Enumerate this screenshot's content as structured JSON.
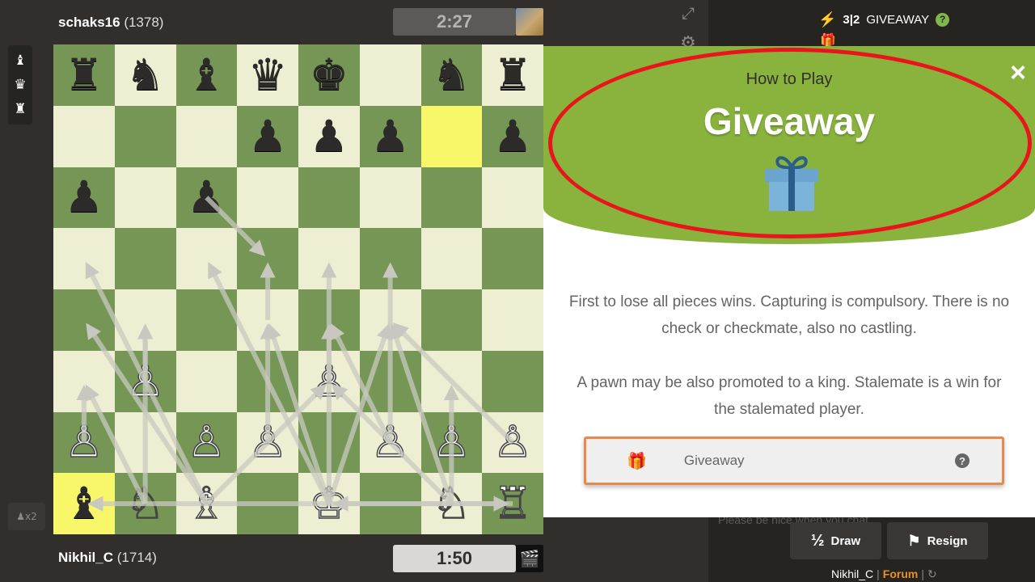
{
  "players": {
    "top": {
      "name": "schaks16",
      "rating": "(1378)",
      "clock": "2:27"
    },
    "bottom": {
      "name": "Nikhil_C",
      "rating": "(1714)",
      "clock": "1:50"
    }
  },
  "captured_pieces": [
    "♝",
    "♛",
    "♜"
  ],
  "move_counter": "♟x2",
  "board": {
    "colors": {
      "light": "#eeeed2",
      "dark": "#769656",
      "highlight": "#f7f769"
    },
    "highlights": [
      "g7",
      "a1"
    ],
    "pieces": {
      "a8": "♜",
      "b8": "♞",
      "c8": "♝",
      "d8": "♛",
      "e8": "♚",
      "g8": "♞",
      "h8": "♜",
      "d7": "♟",
      "e7": "♟",
      "f7": "♟",
      "h7": "♟",
      "a6": "♟",
      "c6": "♟",
      "b3": "♙",
      "e3": "♙",
      "a2": "♙",
      "c2": "♙",
      "d2": "♙",
      "f2": "♙",
      "g2": "♙",
      "h2": "♙",
      "a1": "♝",
      "b1": "♘",
      "c1": "♗",
      "e1": "♔",
      "g1": "♘",
      "h1": "♖"
    },
    "black_on_squares": [
      "a8",
      "b8",
      "c8",
      "d8",
      "e8",
      "g8",
      "h8",
      "d7",
      "e7",
      "f7",
      "h7",
      "a6",
      "c6",
      "a1"
    ],
    "arrows": [
      [
        "c6",
        "d5"
      ],
      [
        "d4",
        "d5"
      ],
      [
        "b1",
        "a3"
      ],
      [
        "b1",
        "b4"
      ],
      [
        "c1",
        "a4"
      ],
      [
        "c1",
        "e3"
      ],
      [
        "c1",
        "a5"
      ],
      [
        "a2",
        "a3"
      ],
      [
        "b3",
        "b4"
      ],
      [
        "e1",
        "d4"
      ],
      [
        "e1",
        "c5"
      ],
      [
        "e1",
        "f4"
      ],
      [
        "g1",
        "e3"
      ],
      [
        "g1",
        "f4"
      ],
      [
        "g1",
        "g3"
      ],
      [
        "g1",
        "a1"
      ],
      [
        "g1",
        "h1"
      ],
      [
        "f2",
        "e4"
      ],
      [
        "e3",
        "e4"
      ],
      [
        "f2",
        "f5"
      ],
      [
        "d2",
        "d4"
      ],
      [
        "e1",
        "e5"
      ],
      [
        "h2",
        "f4"
      ],
      [
        "h1",
        "e1"
      ]
    ]
  },
  "sidebar": {
    "mode_icon": "lightning-bolt-icon",
    "time_control": "3|2",
    "mode_name": "GIVEAWAY",
    "help": "?"
  },
  "modal": {
    "subtitle": "How to Play",
    "title": "Giveaway",
    "close": "×",
    "paragraph1": "First to lose all pieces wins. Capturing is compulsory. There is no check or checkmate, also no castling.",
    "paragraph2": "A pawn may be also promoted to a king. Stalemate is a win for the stalemated player.",
    "variant_label": "Giveaway",
    "variant_help": "?"
  },
  "chat": {
    "placeholder": "Please be nice when you chat"
  },
  "actions": {
    "draw_label": "Draw",
    "draw_icon": "½",
    "resign_label": "Resign"
  },
  "footer": {
    "user": "Nikhil_C",
    "separator": "|",
    "forum": "Forum",
    "refresh": "↻"
  },
  "accent": {
    "green": "#8ab33e",
    "red_circle": "#e8161c",
    "orange_border": "#e8884d"
  }
}
